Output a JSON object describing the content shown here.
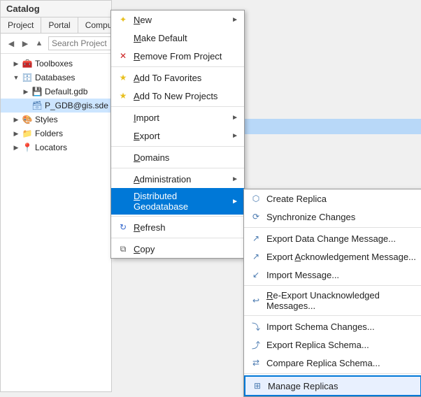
{
  "catalog": {
    "title": "Catalog",
    "tabs": [
      "Project",
      "Portal",
      "Compute"
    ],
    "search_placeholder": "Search Project",
    "tree": [
      {
        "label": "Toolboxes",
        "level": 1,
        "type": "toolbox",
        "expanded": false
      },
      {
        "label": "Databases",
        "level": 1,
        "type": "db",
        "expanded": true
      },
      {
        "label": "Default.gdb",
        "level": 2,
        "type": "gdb"
      },
      {
        "label": "P_GDB@gis.sde",
        "level": 2,
        "type": "sde",
        "selected": true
      },
      {
        "label": "Styles",
        "level": 1,
        "type": "style",
        "expanded": false
      },
      {
        "label": "Folders",
        "level": 1,
        "type": "folder",
        "expanded": false
      },
      {
        "label": "Locators",
        "level": 1,
        "type": "locator",
        "expanded": false
      }
    ]
  },
  "context_menu_1": {
    "items": [
      {
        "id": "new",
        "label": "New",
        "underline": "N",
        "has_submenu": true,
        "icon": "sun"
      },
      {
        "id": "make_default",
        "label": "Make Default",
        "underline": "M",
        "has_submenu": false,
        "icon": null
      },
      {
        "id": "remove",
        "label": "Remove From Project",
        "underline": "R",
        "has_submenu": false,
        "icon": "x"
      },
      {
        "id": "sep1",
        "separator": true
      },
      {
        "id": "add_favorites",
        "label": "Add To Favorites",
        "underline": "A",
        "has_submenu": false,
        "icon": "star"
      },
      {
        "id": "add_new",
        "label": "Add To New Projects",
        "underline": "A",
        "has_submenu": false,
        "icon": "star"
      },
      {
        "id": "sep2",
        "separator": true
      },
      {
        "id": "import",
        "label": "Import",
        "underline": "I",
        "has_submenu": true,
        "icon": null
      },
      {
        "id": "export",
        "label": "Export",
        "underline": "E",
        "has_submenu": true,
        "icon": null
      },
      {
        "id": "sep3",
        "separator": true
      },
      {
        "id": "domains",
        "label": "Domains",
        "underline": "D",
        "has_submenu": false,
        "icon": null
      },
      {
        "id": "sep4",
        "separator": true
      },
      {
        "id": "administration",
        "label": "Administration",
        "underline": "A",
        "has_submenu": true,
        "icon": null
      },
      {
        "id": "distributed",
        "label": "Distributed Geodatabase",
        "underline": "D",
        "has_submenu": true,
        "icon": null,
        "active": true
      },
      {
        "id": "sep5",
        "separator": true
      },
      {
        "id": "refresh",
        "label": "Refresh",
        "underline": "R",
        "has_submenu": false,
        "icon": "refresh"
      },
      {
        "id": "sep6",
        "separator": true
      },
      {
        "id": "copy",
        "label": "Copy",
        "underline": "C",
        "has_submenu": false,
        "icon": "copy"
      }
    ]
  },
  "context_menu_3": {
    "items": [
      {
        "id": "create_replica",
        "label": "Create Replica",
        "icon": "replica"
      },
      {
        "id": "synchronize",
        "label": "Synchronize Changes",
        "icon": "sync"
      },
      {
        "id": "sep1",
        "separator": true
      },
      {
        "id": "export_data",
        "label": "Export Data Change Message...",
        "icon": "export"
      },
      {
        "id": "export_ack",
        "label": "Export Acknowledgement Message...",
        "icon": "export"
      },
      {
        "id": "import_msg",
        "label": "Import Message...",
        "icon": "import"
      },
      {
        "id": "sep2",
        "separator": true
      },
      {
        "id": "reexport",
        "label": "Re-Export Unacknowledged Messages...",
        "icon": "reexport"
      },
      {
        "id": "sep3",
        "separator": true
      },
      {
        "id": "import_schema",
        "label": "Import Schema Changes...",
        "icon": "schema"
      },
      {
        "id": "export_schema",
        "label": "Export Replica Schema...",
        "icon": "schema"
      },
      {
        "id": "compare_schema",
        "label": "Compare Replica Schema...",
        "icon": "schema"
      },
      {
        "id": "sep4",
        "separator": true
      },
      {
        "id": "manage_replicas",
        "label": "Manage Replicas",
        "icon": "manage",
        "selected": true
      }
    ]
  }
}
